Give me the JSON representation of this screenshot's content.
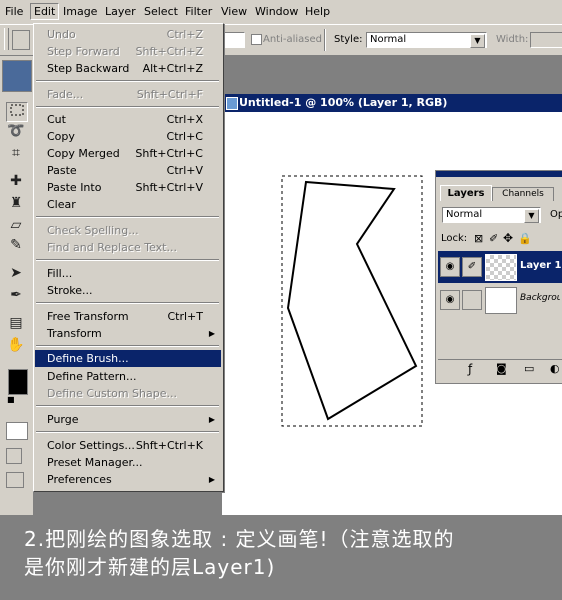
{
  "menubar": {
    "items": [
      {
        "label": "File"
      },
      {
        "label": "Edit"
      },
      {
        "label": "Image"
      },
      {
        "label": "Layer"
      },
      {
        "label": "Select"
      },
      {
        "label": "Filter"
      },
      {
        "label": "View"
      },
      {
        "label": "Window"
      },
      {
        "label": "Help"
      }
    ]
  },
  "options": {
    "anti_aliased_label": "Anti-aliased",
    "style_label": "Style:",
    "style_value": "Normal",
    "width_label": "Width:"
  },
  "edit_menu": {
    "items": [
      {
        "label": "Undo",
        "shortcut": "Ctrl+Z"
      },
      {
        "label": "Step Forward",
        "shortcut": "Shft+Ctrl+Z"
      },
      {
        "label": "Step Backward",
        "shortcut": "Alt+Ctrl+Z"
      },
      {
        "label": "Fade...",
        "shortcut": "Shft+Ctrl+F"
      },
      {
        "label": "Cut",
        "shortcut": "Ctrl+X"
      },
      {
        "label": "Copy",
        "shortcut": "Ctrl+C"
      },
      {
        "label": "Copy Merged",
        "shortcut": "Shft+Ctrl+C"
      },
      {
        "label": "Paste",
        "shortcut": "Ctrl+V"
      },
      {
        "label": "Paste Into",
        "shortcut": "Shft+Ctrl+V"
      },
      {
        "label": "Clear",
        "shortcut": ""
      },
      {
        "label": "Check Spelling...",
        "shortcut": ""
      },
      {
        "label": "Find and Replace Text...",
        "shortcut": ""
      },
      {
        "label": "Fill...",
        "shortcut": ""
      },
      {
        "label": "Stroke...",
        "shortcut": ""
      },
      {
        "label": "Free Transform",
        "shortcut": "Ctrl+T"
      },
      {
        "label": "Transform",
        "shortcut": ""
      },
      {
        "label": "Define Brush...",
        "shortcut": ""
      },
      {
        "label": "Define Pattern...",
        "shortcut": ""
      },
      {
        "label": "Define Custom Shape...",
        "shortcut": ""
      },
      {
        "label": "Purge",
        "shortcut": ""
      },
      {
        "label": "Color Settings...",
        "shortcut": "Shft+Ctrl+K"
      },
      {
        "label": "Preset Manager...",
        "shortcut": ""
      },
      {
        "label": "Preferences",
        "shortcut": ""
      }
    ]
  },
  "document": {
    "title": "Untitled-1 @ 100% (Layer 1, RGB)"
  },
  "layers_palette": {
    "tab_layers": "Layers",
    "tab_channels": "Channels",
    "blend_mode": "Normal",
    "opacity_label": "Op",
    "lock_label": "Lock:",
    "layers": [
      {
        "name": "Layer 1"
      },
      {
        "name": "Background"
      }
    ]
  },
  "caption": {
    "line1": "2.把刚绘的图象选取 : 定义画笔!（注意选取的",
    "line2": "是你刚才新建的层Layer1)"
  },
  "colors": {
    "selection": "#0a246a",
    "face": "#d4d0c8",
    "workspace": "#808080"
  }
}
